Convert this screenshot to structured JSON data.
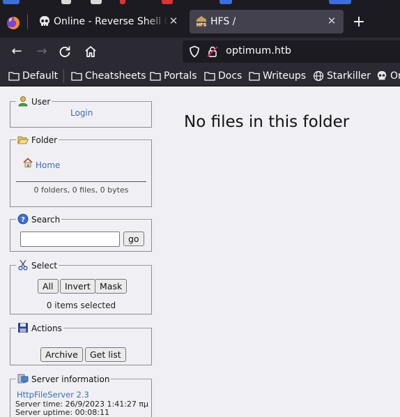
{
  "browser": {
    "tabs": [
      {
        "title": "Online - Reverse Shell Generator",
        "icon": "skull-icon",
        "active": false
      },
      {
        "title": "HFS /",
        "icon": "hfs-icon",
        "active": true
      }
    ],
    "new_tab_label": "+",
    "url": "optimum.htb",
    "bookmarks": [
      {
        "label": "Default",
        "icon": "folder-icon"
      },
      {
        "label": "Cheatsheets",
        "icon": "folder-icon"
      },
      {
        "label": "Portals",
        "icon": "folder-icon"
      },
      {
        "label": "Docs",
        "icon": "folder-icon"
      },
      {
        "label": "Writeups",
        "icon": "folder-icon"
      },
      {
        "label": "Starkiller",
        "icon": "globe-icon"
      },
      {
        "label": "Or",
        "icon": "skull-icon"
      }
    ]
  },
  "hfs": {
    "user": {
      "title": "User",
      "login_label": "Login"
    },
    "folder": {
      "title": "Folder",
      "home_label": "Home",
      "stats": "0 folders, 0 files, 0 bytes"
    },
    "search": {
      "title": "Search",
      "value": "",
      "go_label": "go"
    },
    "select": {
      "title": "Select",
      "all_label": "All",
      "invert_label": "Invert",
      "mask_label": "Mask",
      "status": "0 items selected"
    },
    "actions": {
      "title": "Actions",
      "archive_label": "Archive",
      "getlist_label": "Get list"
    },
    "server": {
      "title": "Server information",
      "version_link": "HttpFileServer 2.3",
      "time": "Server time: 26/9/2023 1:41:27 πμ",
      "uptime": "Server uptime: 00:08:11"
    },
    "message": "No files in this folder"
  },
  "colors": {
    "chrome_dark": "#1c1b22",
    "chrome_mid": "#2b2a33",
    "active_tab": "#42414d",
    "link": "#3a6bc0",
    "page_bg": "#f0f0f4"
  }
}
